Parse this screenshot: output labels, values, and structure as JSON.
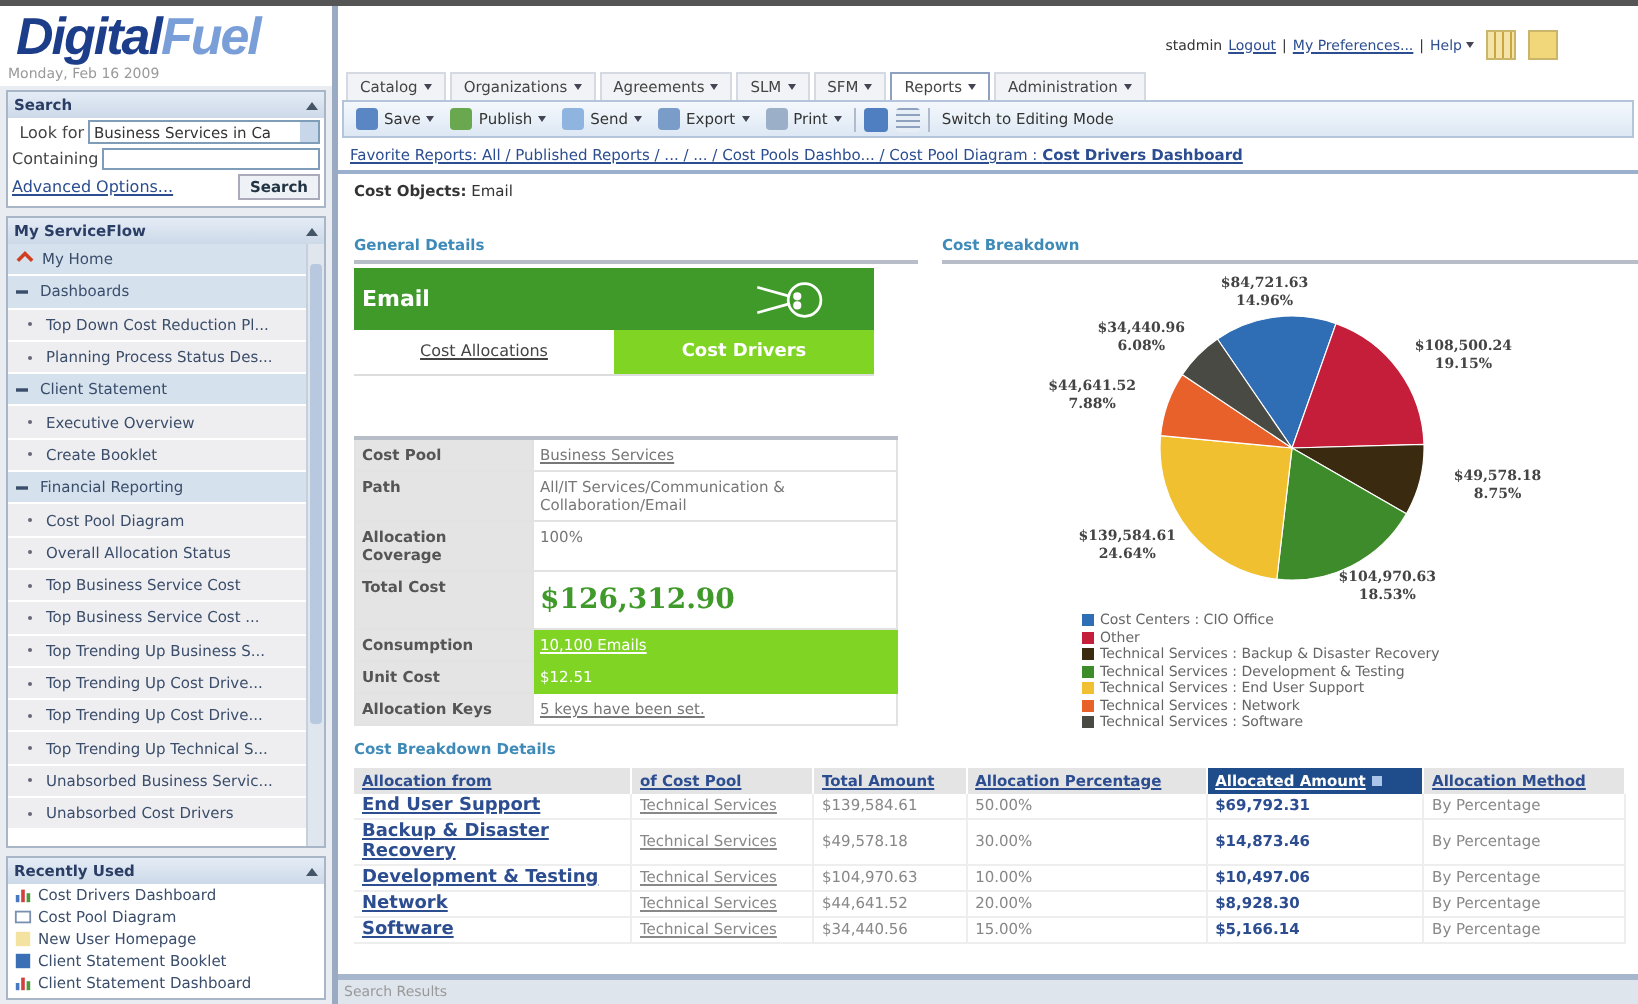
{
  "header": {
    "logo_first": "Digital",
    "logo_second": "Fuel",
    "date": "Monday, Feb 16 2009",
    "user": "stadmin",
    "links": [
      "Logout",
      "My Preferences...",
      "Help"
    ],
    "separator": "|"
  },
  "search": {
    "title": "Search",
    "look_for_label": "Look for",
    "look_for_value": "Business Services in Ca",
    "containing_label": "Containing",
    "advanced_link": "Advanced Options...",
    "button": "Search"
  },
  "serviceflow": {
    "title": "My ServiceFlow",
    "items": [
      {
        "label": "My Home",
        "kind": "home"
      },
      {
        "label": "Dashboards",
        "kind": "group",
        "expanded": true,
        "children": [
          {
            "label": "Top Down Cost Reduction Pl..."
          },
          {
            "label": "Planning Process Status Des..."
          }
        ]
      },
      {
        "label": "Client Statement",
        "kind": "group",
        "expanded": true,
        "children": [
          {
            "label": "Executive Overview"
          },
          {
            "label": "Create Booklet"
          }
        ]
      },
      {
        "label": "Financial Reporting",
        "kind": "group",
        "expanded": true,
        "children": [
          {
            "label": "Cost Pool Diagram"
          },
          {
            "label": "Overall Allocation Status"
          },
          {
            "label": "Top Business Service Cost"
          },
          {
            "label": "Top Business Service Cost ..."
          },
          {
            "label": "Top Trending Up Business S..."
          },
          {
            "label": "Top Trending Up Cost Drive..."
          },
          {
            "label": "Top Trending Up Cost Drive..."
          },
          {
            "label": "Top Trending Up Technical S..."
          },
          {
            "label": "Unabsorbed Business Servic..."
          },
          {
            "label": "Unabsorbed Cost Drivers"
          }
        ]
      }
    ]
  },
  "recently_used": {
    "title": "Recently Used",
    "items": [
      {
        "label": "Cost Drivers Dashboard",
        "kind": "dashboard"
      },
      {
        "label": "Cost Pool Diagram",
        "kind": "diagram"
      },
      {
        "label": "New User Homepage",
        "kind": "page"
      },
      {
        "label": "Client Statement Booklet",
        "kind": "booklet"
      },
      {
        "label": "Client Statement Dashboard",
        "kind": "dashboard"
      }
    ]
  },
  "menu_tabs": [
    {
      "label": "Catalog",
      "selected": false
    },
    {
      "label": "Organizations",
      "selected": false
    },
    {
      "label": "Agreements",
      "selected": false
    },
    {
      "label": "SLM",
      "selected": false
    },
    {
      "label": "SFM",
      "selected": false
    },
    {
      "label": "Reports",
      "selected": true
    },
    {
      "label": "Administration",
      "selected": false
    }
  ],
  "toolbar": {
    "buttons": [
      {
        "label": "Save",
        "kind": "save"
      },
      {
        "label": "Publish",
        "kind": "publish"
      },
      {
        "label": "Send",
        "kind": "send"
      },
      {
        "label": "Export",
        "kind": "export"
      },
      {
        "label": "Print",
        "kind": "print"
      }
    ],
    "switch_mode": "Switch to Editing Mode"
  },
  "breadcrumb": "Favorite Reports: All / Published Reports / ... / ... / Cost Pools Dashbo... / Cost Pool Diagram : **Cost Drivers Dashboard**",
  "cost_objects": "**Cost Objects:** Email",
  "general_details": {
    "title": "General Details",
    "card_title": "Email",
    "tabs": [
      {
        "label": "Cost Allocations",
        "selected": false
      },
      {
        "label": "Cost Drivers",
        "selected": true
      }
    ],
    "rows": [
      {
        "label": "Cost Pool",
        "value": "Business Services",
        "kind": "link",
        "highlighted": false
      },
      {
        "label": "Path",
        "value": "All/IT Services/Communication & Collaboration/Email",
        "kind": "text",
        "highlighted": false
      },
      {
        "label": "Allocation Coverage",
        "value": "100%",
        "kind": "text",
        "highlighted": false
      },
      {
        "label": "Total Cost",
        "value": "$126,312.90",
        "kind": "big",
        "highlighted": false
      },
      {
        "label": "Consumption",
        "value": "10,100 Emails",
        "kind": "link",
        "highlighted": true
      },
      {
        "label": "Unit Cost",
        "value": "$12.51",
        "kind": "text",
        "highlighted": true
      },
      {
        "label": "Allocation Keys",
        "value": "5 keys have been set.",
        "kind": "link",
        "highlighted": false
      }
    ]
  },
  "cost_breakdown": {
    "title": "Cost Breakdown",
    "chart_data": {
      "type": "pie",
      "categories": [
        "Cost Centers : CIO Office",
        "Other",
        "Technical Services : Backup & Disaster Recovery",
        "Technical Services : Development & Testing",
        "Technical Services : End User Support",
        "Technical Services : Network",
        "Technical Services : Software"
      ],
      "colors": [
        "#2f6db4",
        "#c41e3a",
        "#3a2a10",
        "#3d8b2a",
        "#f0c030",
        "#e8602a",
        "#4a4a44"
      ],
      "values": [
        14.96,
        19.15,
        8.75,
        18.53,
        24.64,
        7.88,
        6.08
      ],
      "data_labels": true,
      "legend": "bottom",
      "value_labels": [
        [
          "$84,721.63",
          "14.96%"
        ],
        [
          "$108,500.24",
          "19.15%"
        ],
        [
          "$49,578.18",
          "8.75%"
        ],
        [
          "$104,970.63",
          "18.53%"
        ],
        [
          "$139,584.61",
          "24.64%"
        ],
        [
          "$44,641.52",
          "7.88%"
        ],
        [
          "$34,440.96",
          "6.08%"
        ]
      ]
    }
  },
  "details_table": {
    "title": "Cost Breakdown Details",
    "columns": [
      {
        "label": "Allocation from",
        "selected": false
      },
      {
        "label": "of Cost Pool",
        "selected": false
      },
      {
        "label": "Total Amount",
        "selected": false
      },
      {
        "label": "Allocation Percentage",
        "selected": false
      },
      {
        "label": "Allocated Amount",
        "selected": true
      },
      {
        "label": "Allocation Method",
        "selected": false
      }
    ],
    "rows": [
      [
        "End User Support",
        "Technical Services",
        "$139,584.61",
        "50.00%",
        "$69,792.31",
        "By Percentage"
      ],
      [
        "Backup & Disaster Recovery",
        "Technical Services",
        "$49,578.18",
        "30.00%",
        "$14,873.46",
        "By Percentage"
      ],
      [
        "Development & Testing",
        "Technical Services",
        "$104,970.63",
        "10.00%",
        "$10,497.06",
        "By Percentage"
      ],
      [
        "Network",
        "Technical Services",
        "$44,641.52",
        "20.00%",
        "$8,928.30",
        "By Percentage"
      ],
      [
        "Software",
        "Technical Services",
        "$34,440.56",
        "15.00%",
        "$5,166.14",
        "By Percentage"
      ]
    ]
  },
  "status_bar": "Search Results"
}
